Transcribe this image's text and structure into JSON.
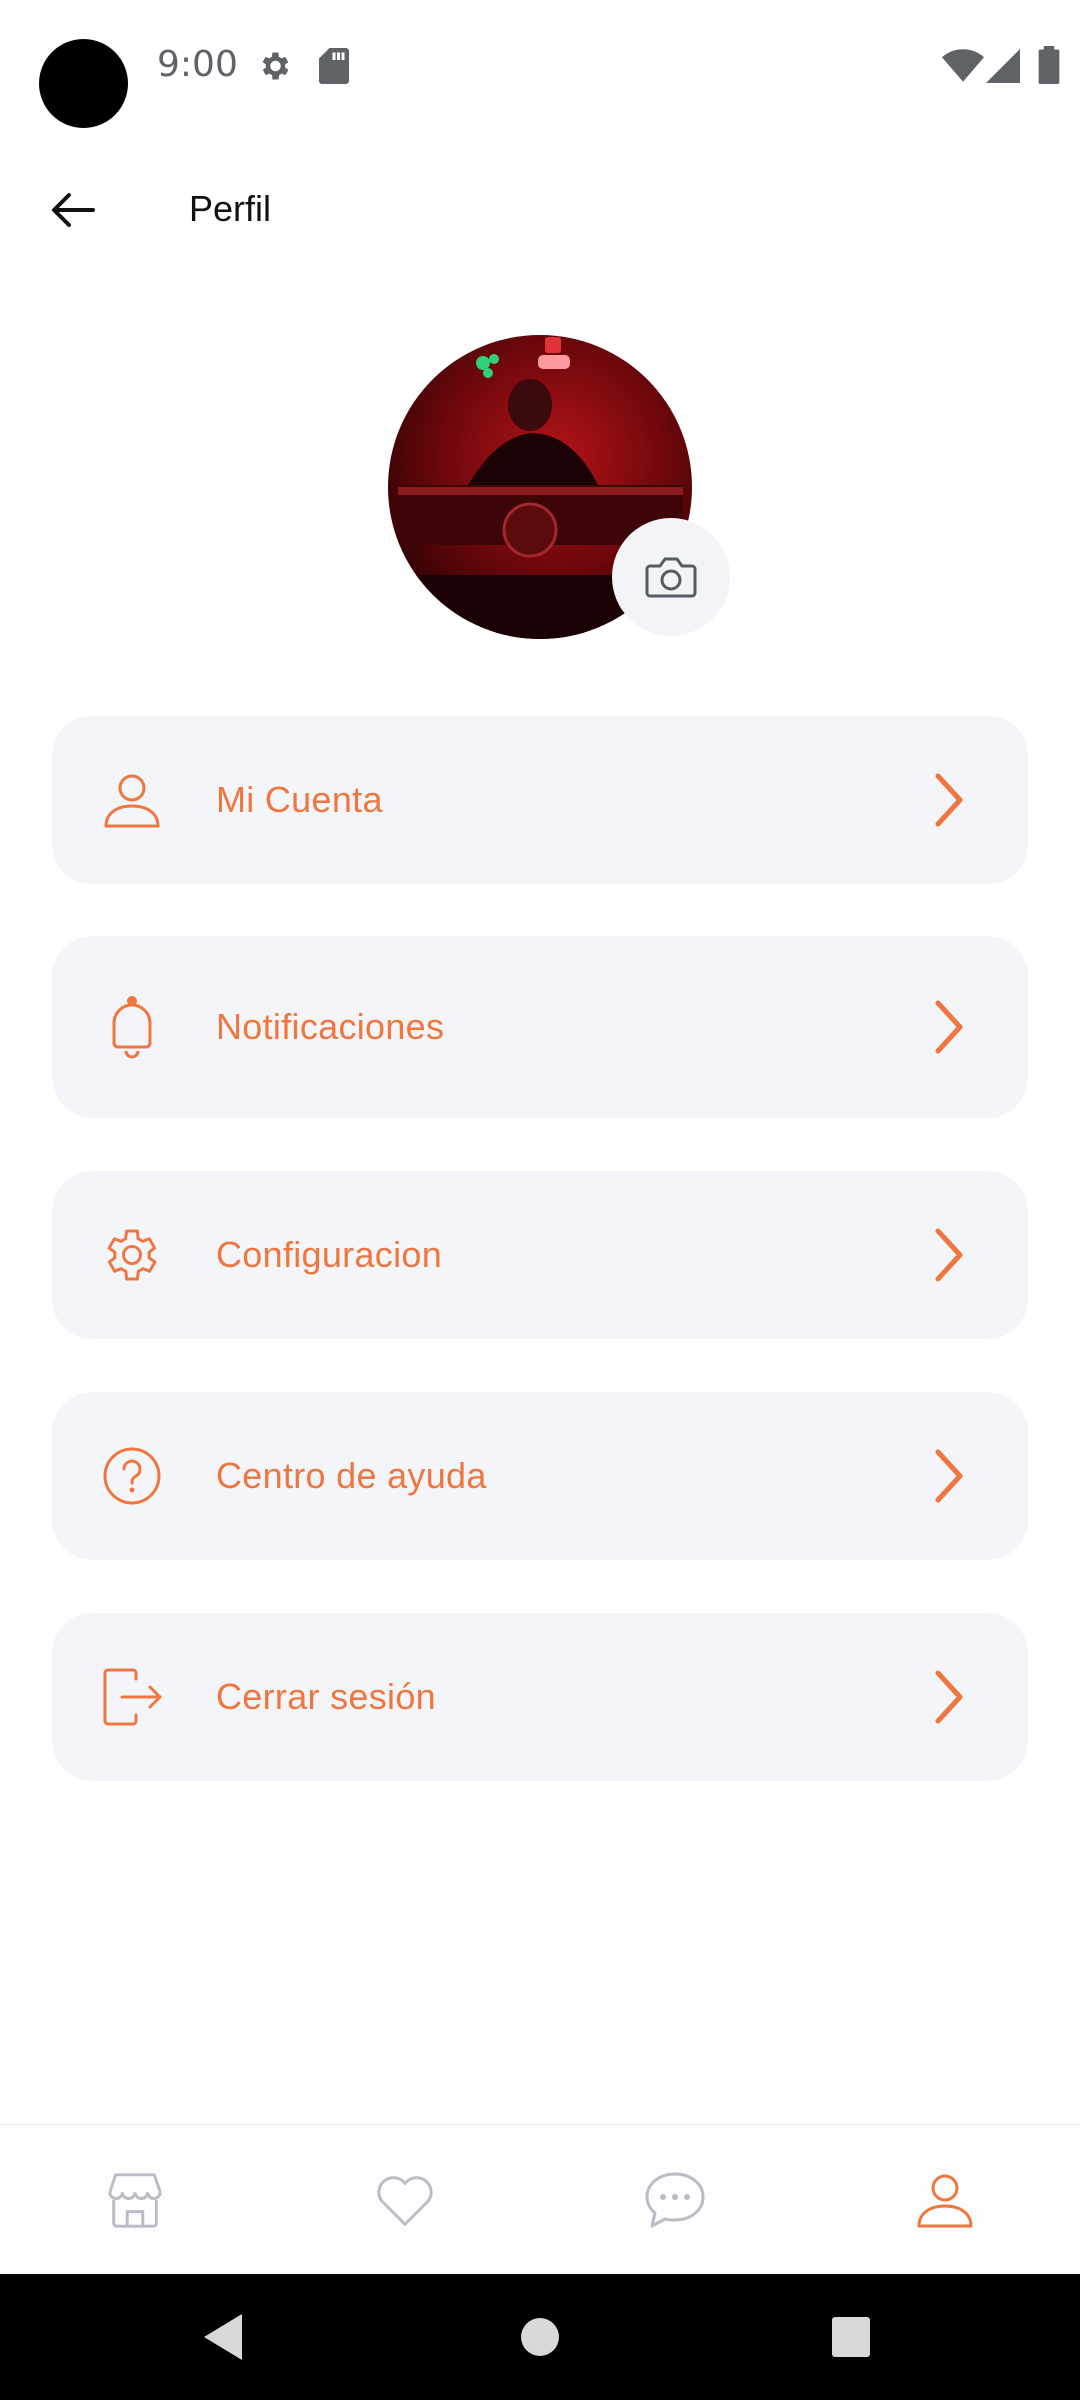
{
  "status_bar": {
    "time": "9:00",
    "icons": [
      "gear-icon",
      "sd-card-icon",
      "wifi-icon",
      "signal-icon",
      "battery-icon"
    ]
  },
  "app_bar": {
    "title": "Perfil",
    "back_icon": "arrow-left-icon"
  },
  "profile": {
    "avatar_icon": "profile-photo",
    "camera_icon": "camera-icon"
  },
  "menu": {
    "items": [
      {
        "label": "Mi Cuenta",
        "icon": "user-icon"
      },
      {
        "label": "Notificaciones",
        "icon": "bell-icon"
      },
      {
        "label": "Configuracion",
        "icon": "gear-icon"
      },
      {
        "label": "Centro de ayuda",
        "icon": "help-circle-icon"
      },
      {
        "label": "Cerrar sesión",
        "icon": "logout-icon"
      }
    ]
  },
  "bottom_nav": {
    "items": [
      {
        "icon": "store-icon",
        "active": false
      },
      {
        "icon": "heart-icon",
        "active": false
      },
      {
        "icon": "chat-icon",
        "active": false
      },
      {
        "icon": "user-icon",
        "active": true
      }
    ]
  },
  "colors": {
    "accent": "#f0763f",
    "card_bg": "#f4f5f9",
    "inactive_icon": "#b9bcc6"
  }
}
